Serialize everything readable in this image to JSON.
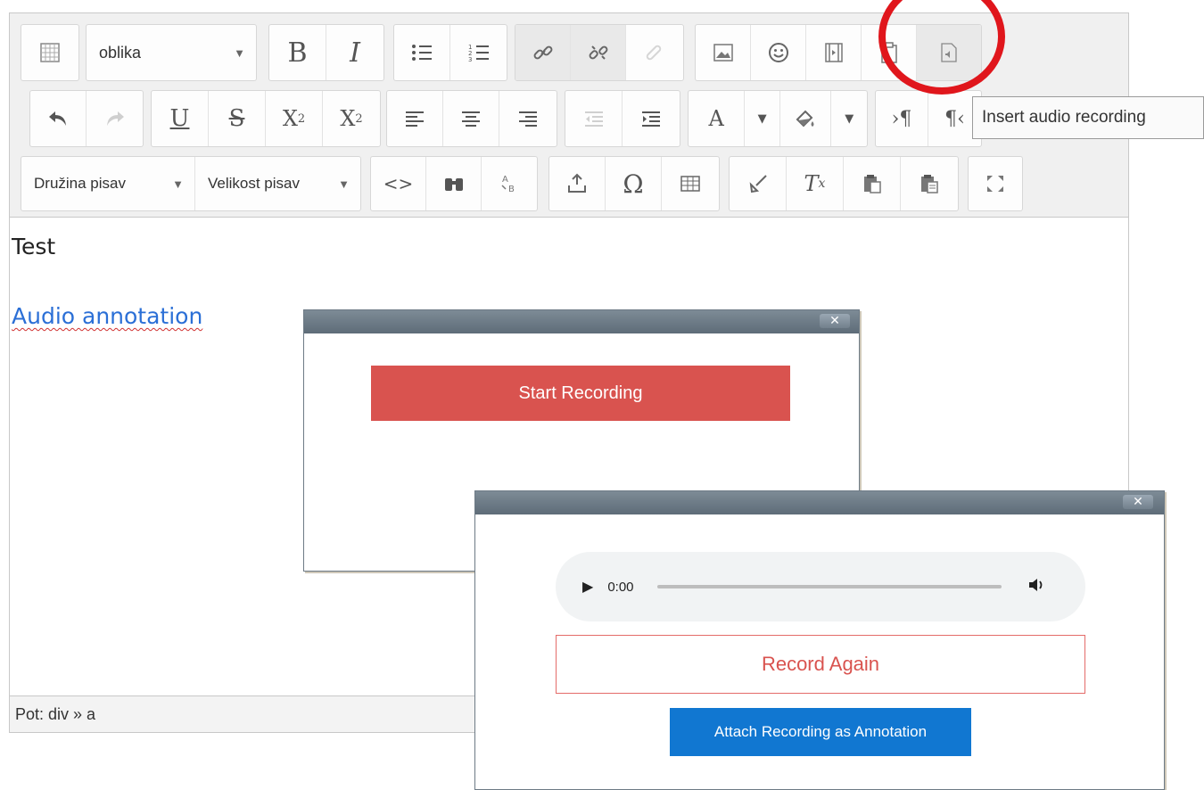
{
  "toolbar": {
    "row1": {
      "format_select": "oblika",
      "tooltip": "Insert audio recording"
    },
    "row3": {
      "font_family": "Družina pisav",
      "font_size": "Velikost pisav"
    },
    "icons": {
      "bold": "B",
      "italic": "I",
      "underline": "U",
      "strike": "S",
      "subscript": "X",
      "subscript_mark": "2",
      "superscript": "X",
      "superscript_mark": "2",
      "text_color": "A",
      "omega": "Ω",
      "clear_format": "T",
      "clear_format_mark": "x",
      "code": "<>"
    }
  },
  "content": {
    "paragraph": "Test",
    "link_text": "Audio annotation"
  },
  "status": {
    "path": "Pot: div » a"
  },
  "dialog_recorder": {
    "start_label": "Start Recording"
  },
  "dialog_playback": {
    "time": "0:00",
    "record_again_label": "Record Again",
    "attach_label": "Attach Recording as Annotation"
  },
  "colors": {
    "highlight_circle": "#e0161c",
    "start_button": "#d9534f",
    "attach_button": "#1177d1",
    "link": "#2b6fd6"
  }
}
